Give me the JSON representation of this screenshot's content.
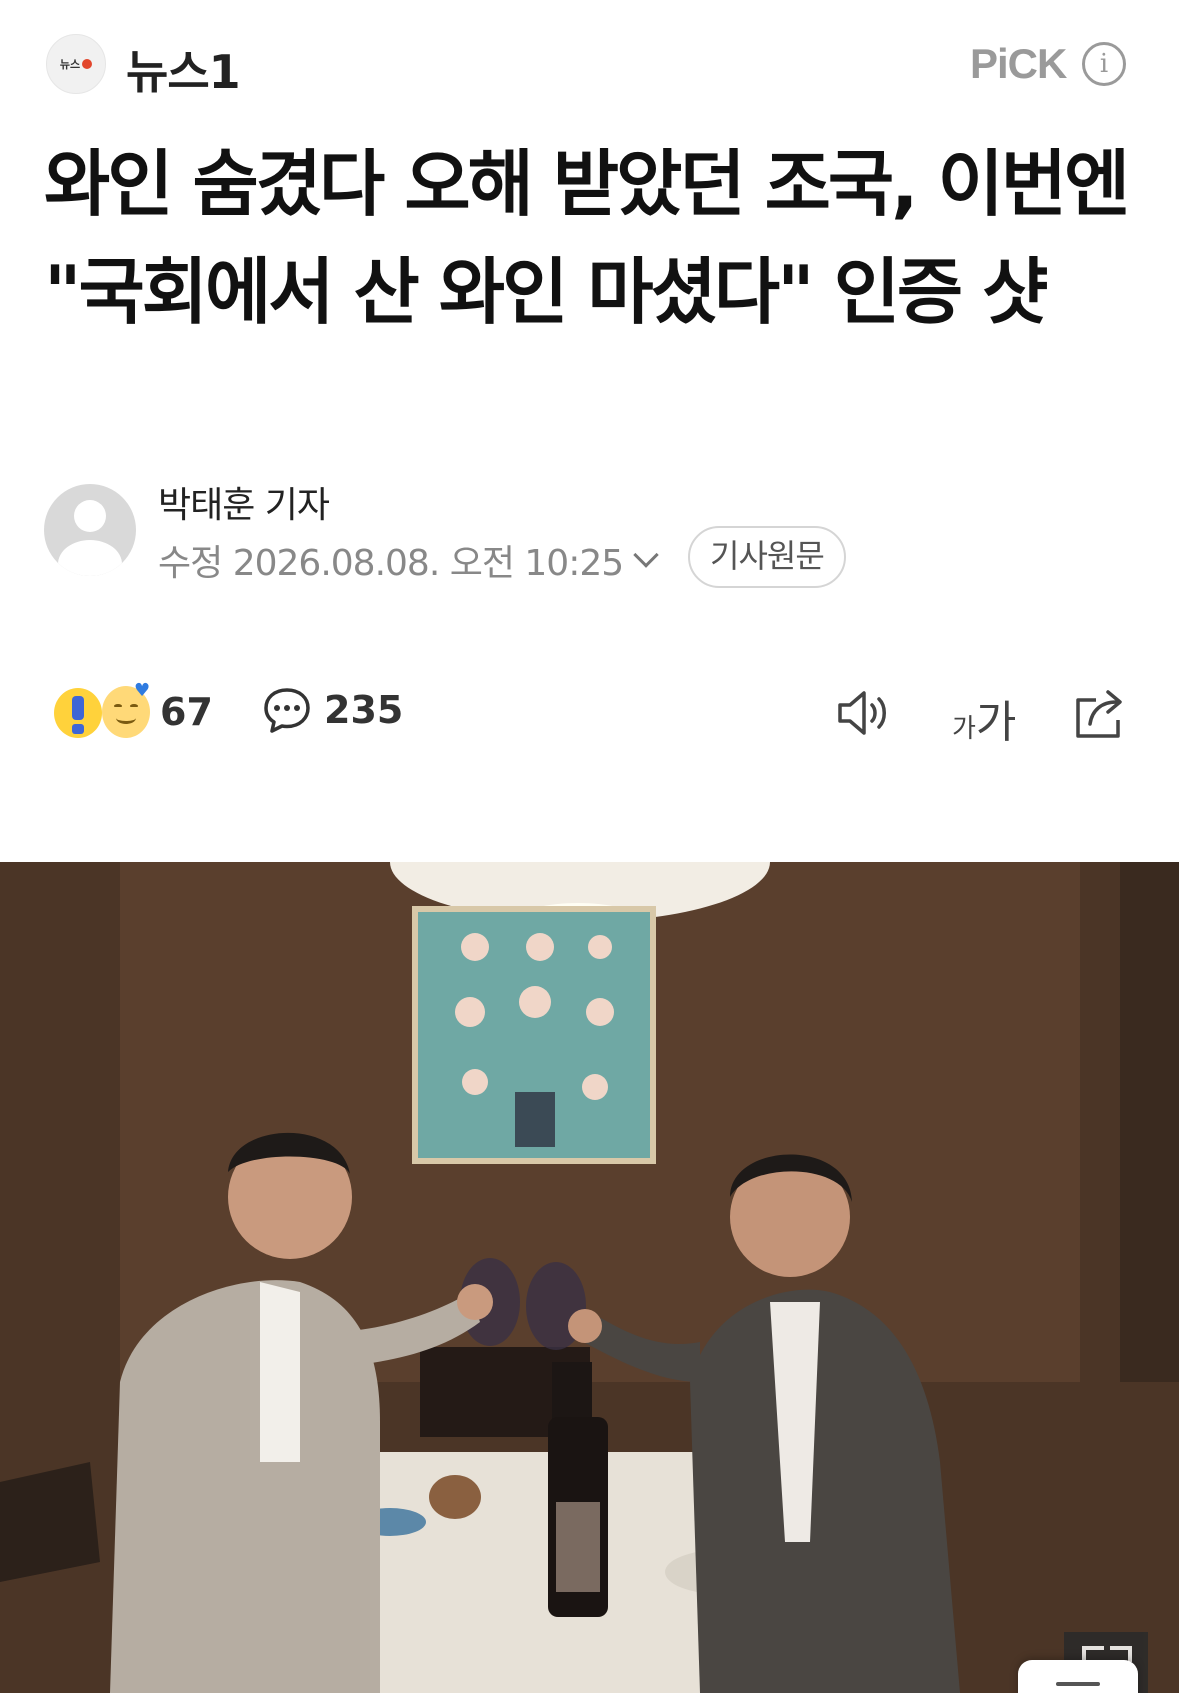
{
  "header": {
    "press_logo_text": "뉴스",
    "press_name": "뉴스1",
    "pick_label": "PiCK",
    "info_icon": "info-circle-icon"
  },
  "article": {
    "title": "와인 숨겼다 오해 받았던 조국, 이번엔 \"국회에서 산 와인 마셨다\" 인증 샷",
    "reporter": "박태훈 기자",
    "edit_label": "수정",
    "datetime": "2026.08.08. 오전 10:25",
    "original_button": "기사원문"
  },
  "actions": {
    "reaction_count": "67",
    "comment_count": "235",
    "font_small": "가",
    "font_big": "가",
    "icons": [
      "reaction-emoji-icon",
      "comment-icon",
      "speaker-icon",
      "font-size-icon",
      "share-icon"
    ]
  },
  "photo": {
    "description_icon": "article-photo",
    "expand_icon": "expand-icon"
  },
  "colors": {
    "text": "#111111",
    "muted": "#888888",
    "pick": "#9a9a9a",
    "press_accent": "#e2462c"
  }
}
